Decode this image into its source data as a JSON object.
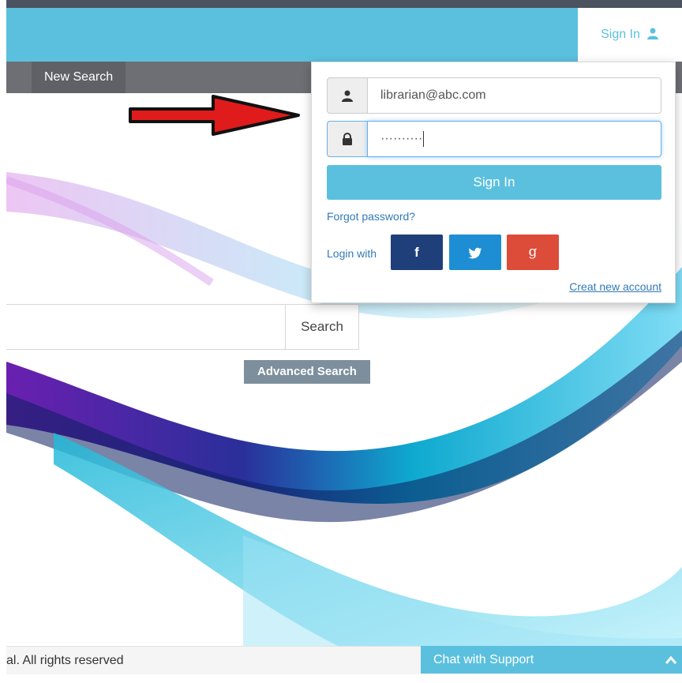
{
  "header": {
    "signin_label": "Sign In",
    "accent_color": "#5bc0de"
  },
  "nav": {
    "new_search_label": "New Search"
  },
  "login": {
    "email_value": "librarian@abc.com",
    "password_value": "··········",
    "signin_button": "Sign In",
    "forgot_password": "Forgot password?",
    "login_with": "Login with",
    "facebook_glyph": "f",
    "google_glyph": "g",
    "create_account": "Creat new account"
  },
  "search": {
    "button_label": "Search",
    "advanced_label": "Advanced Search"
  },
  "footer": {
    "copyright": "al. All rights reserved",
    "chat_label": "Chat with Support",
    "chat_chevron": "^"
  },
  "icons": {
    "user": "user-icon",
    "lock": "lock-icon",
    "facebook": "facebook-icon",
    "twitter": "twitter-icon",
    "google": "google-plus-icon",
    "arrow": "arrow-annotation"
  }
}
